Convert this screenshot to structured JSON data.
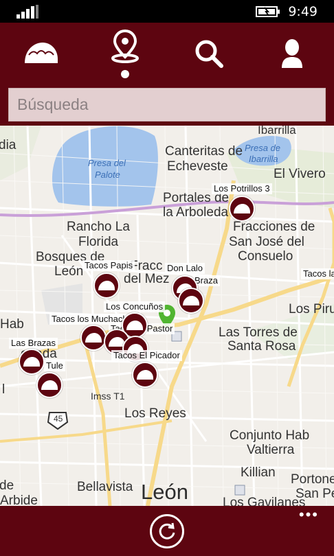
{
  "status": {
    "time": "9:49"
  },
  "nav": {
    "items": [
      "taco-icon",
      "location-icon",
      "search-icon",
      "user-icon"
    ],
    "accent": "#5d0510",
    "selected": "location-icon"
  },
  "search": {
    "placeholder": "Búsqueda",
    "value": ""
  },
  "map": {
    "places": {
      "ibarrilla_top": "Ibarrilla",
      "canteritas": "Canteritas de",
      "echeveste": "Echeveste",
      "presa_ibarrilla": "Presa de",
      "presa_ibarrilla2": "Ibarrilla",
      "el_vivero": "El Vivero",
      "presa_palote": "Presa del",
      "presa_palote2": "Palote",
      "portales": "Portales de",
      "arboleda": "la Arboleda",
      "fracciones": "Fracciones de",
      "san_jose": "San José del",
      "consuelo": "Consuelo",
      "rancho": "Rancho La",
      "florida": "Florida",
      "bosques": "Bosques de",
      "leon_short": "León",
      "fracc": "Fracc",
      "del_mez": "del Mez",
      "hab": "Hab",
      "onada": "onada",
      "los_piru": "Los Piru",
      "torres1": "Las Torres de",
      "torres2": "Santa Rosa",
      "imss": "Imss T1",
      "los_reyes": "Los Reyes",
      "conjunto": "Conjunto Hab",
      "valtierra": "Valtierra",
      "killian": "Killian",
      "portone": "Portone",
      "san_pe": "San Pe",
      "bellavista": "Bellavista",
      "arbide": "Arbide",
      "de_left": "de",
      "leon_city": "León",
      "gavilanes": "Los Gavilanes",
      "tule": "Tule",
      "dia": "dia",
      "highway": "45",
      "letter_l": "l"
    },
    "markers": [
      {
        "label": "Los Potrillos 3"
      },
      {
        "label": "Tacos Papis"
      },
      {
        "label": "Don Lalo"
      },
      {
        "label": "Braza"
      },
      {
        "label": "Tacos la"
      },
      {
        "label": "Los Concuños"
      },
      {
        "label": "Tacos los Muchachos"
      },
      {
        "label": "Ta"
      },
      {
        "label": "Tacos El Pastor"
      },
      {
        "label": "Tacos El Picador"
      },
      {
        "label": "Las Brazas"
      },
      {
        "label": "Tule"
      }
    ]
  },
  "appbar": {
    "more": "•••",
    "refresh": "refresh-icon"
  }
}
